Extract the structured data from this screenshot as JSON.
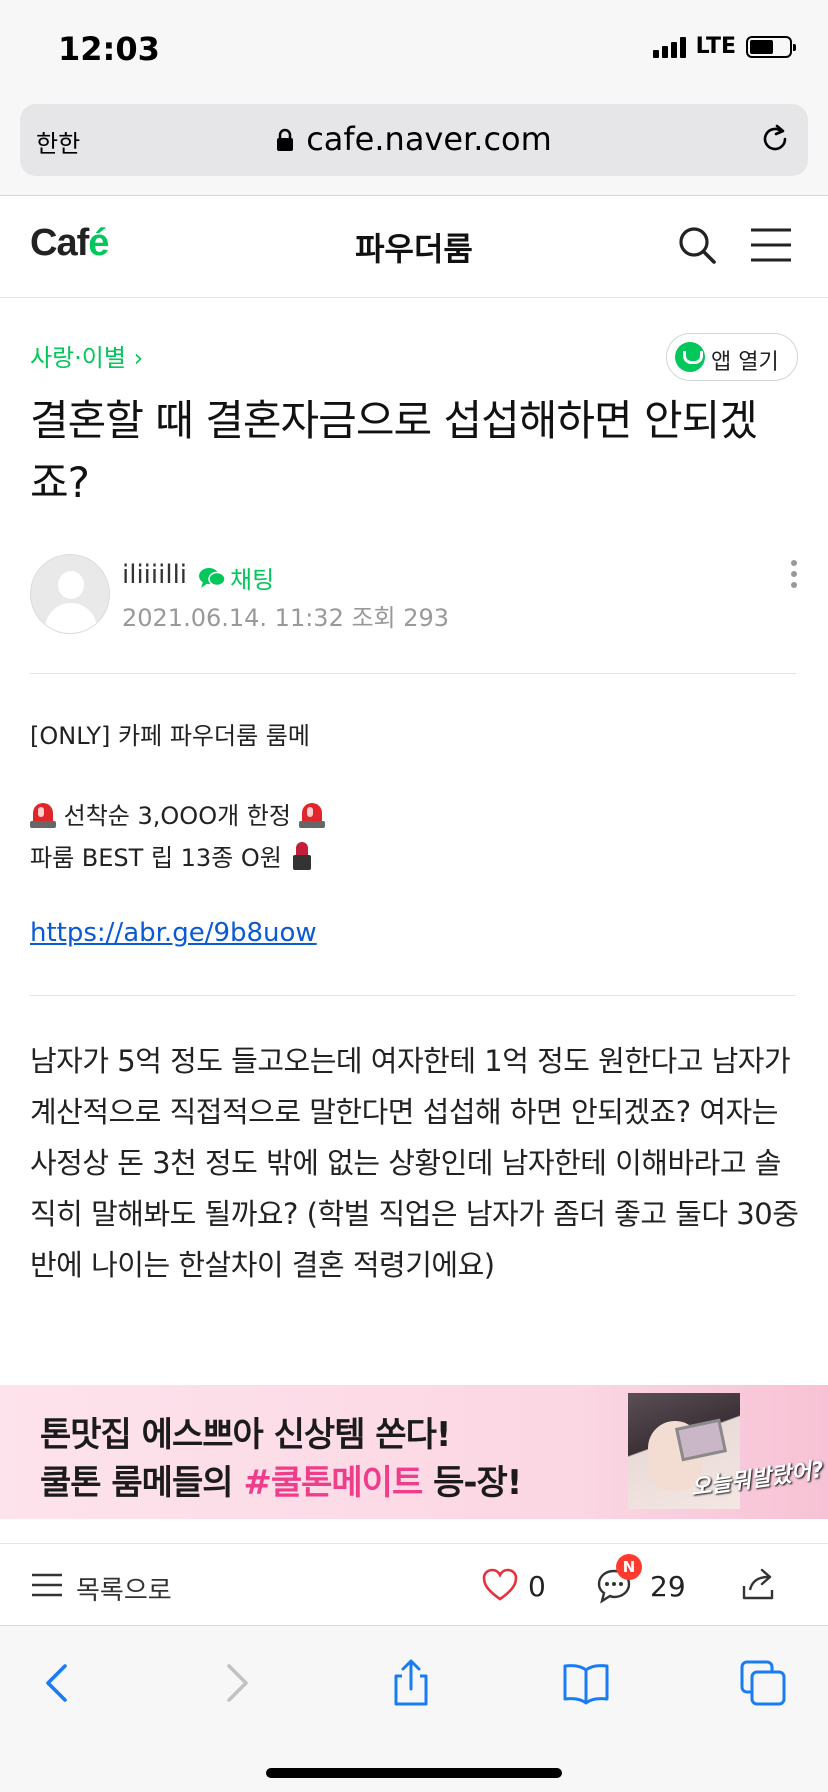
{
  "status_bar": {
    "time": "12:03",
    "network": "LTE"
  },
  "url_bar": {
    "aa_label": "한한",
    "url": "cafe.naver.com"
  },
  "cafe_header": {
    "logo": "Caf",
    "logo_accent": "é",
    "title": "파우더룸",
    "brand_color": "#03c75a"
  },
  "article": {
    "breadcrumb": "사랑·이별 ›",
    "app_open_label": "앱 열기",
    "title": "결혼할 때 결혼자금으로 섭섭해하면 안되겠죠?",
    "author": "iliiiilli",
    "chat_label": "채팅",
    "meta": "2021.06.14. 11:32  조회 293",
    "ad": {
      "line1": "[ONLY] 카페 파우더룸 룸메",
      "line2": "선착순 3,OOO개 한정",
      "line3": "파룸 BEST 립 13종 O원",
      "link": "https://abr.ge/9b8uow"
    },
    "body": "남자가 5억 정도 들고오는데 여자한테 1억 정도 원한다고 남자가 계산적으로 직접적으로 말한다면 섭섭해 하면 안되겠죠? 여자는 사정상 돈 3천 정도 밖에 없는 상황인데 남자한테 이해바라고 솔직히 말해봐도 될까요? (학벌 직업은 남자가 좀더 좋고 둘다 30중반에 나이는 한살차이 결혼 적령기에요)"
  },
  "banner": {
    "line1": "톤맛집 에스쁘아 신상템 쏜다!",
    "line2_prefix": "쿨톤 룸메들의 ",
    "line2_highlight": "#쿨톤메이트",
    "line2_suffix": " 등-장!",
    "caption": "오늘뭐발랐어?"
  },
  "toolbar": {
    "list_label": "목록으로",
    "like_count": "0",
    "comment_badge": "N",
    "comment_count": "29"
  }
}
